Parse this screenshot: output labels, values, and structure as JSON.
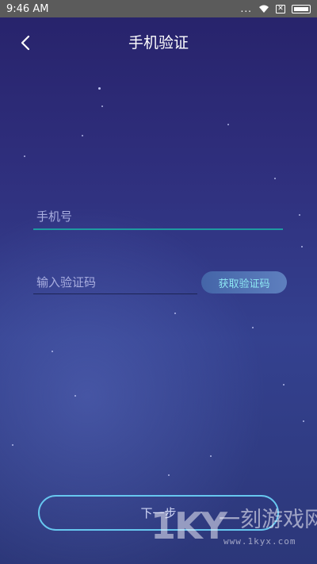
{
  "status_bar": {
    "time": "9:46 AM",
    "dots": "...",
    "icons": [
      "wifi-icon",
      "notification-x-icon",
      "battery-icon"
    ]
  },
  "header": {
    "back_icon": "chevron-left-icon",
    "title": "手机验证"
  },
  "form": {
    "phone": {
      "value": "",
      "placeholder": "手机号"
    },
    "code": {
      "value": "",
      "placeholder": "输入验证码"
    },
    "get_code_label": "获取验证码",
    "next_label": "下一步"
  },
  "watermark": {
    "logo": "1KY",
    "name": "一刻游戏网",
    "url": "www.1kyx.com"
  },
  "colors": {
    "background_top": "#27226a",
    "background_bottom": "#2c3779",
    "status_bar": "#5b5b5b",
    "phone_underline": "#1e9aa1",
    "get_code_text": "#8de7f3",
    "next_border": "#67c7ef"
  }
}
